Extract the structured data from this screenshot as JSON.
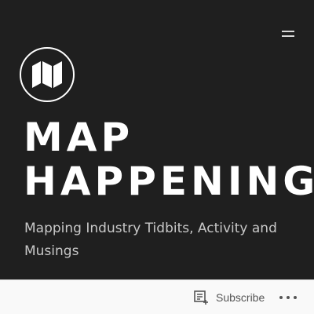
{
  "header": {
    "menu_icon": "hamburger-menu-icon",
    "logo_icon": "folded-map-icon",
    "title_lines": [
      "MAP",
      "HAPPENINGS"
    ],
    "tagline": "Mapping Industry Tidbits, Activity and Musings"
  },
  "action_bar": {
    "subscribe_icon": "reader-subscribe-icon",
    "subscribe_label": "Subscribe",
    "more_icon": "more-horizontal-icon"
  },
  "colors": {
    "background": "#1f1f1f",
    "title": "#ffffff",
    "tagline": "#c8c8c8",
    "action_bar_background": "#f9f9f9",
    "action_bar_text": "#555555"
  }
}
